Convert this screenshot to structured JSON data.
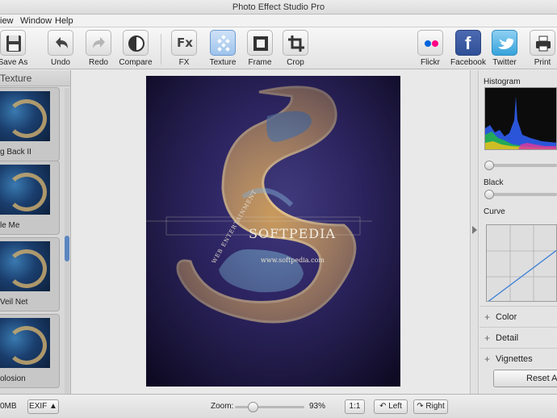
{
  "window": {
    "title": "Photo Effect Studio Pro"
  },
  "menu": [
    "iew",
    "Window",
    "Help"
  ],
  "toolbar": {
    "save_as": "Save As",
    "undo": "Undo",
    "redo": "Redo",
    "compare": "Compare",
    "fx": "FX",
    "texture": "Texture",
    "frame": "Frame",
    "crop": "Crop",
    "flickr": "Flickr",
    "facebook": "Facebook",
    "twitter": "Twitter",
    "print": "Print",
    "fx_glyph": "Fx",
    "facebook_glyph": "f"
  },
  "left_panel": {
    "header": "Texture",
    "thumbnails": [
      {
        "caption": "g Back II"
      },
      {
        "caption": "le Me"
      },
      {
        "caption": "Veil Net"
      },
      {
        "caption": "olosion"
      }
    ]
  },
  "image": {
    "watermark": "SOFTPEDIA",
    "url_text": "www.softpedia.com",
    "side_text": "WEB ENTERTAINMENT"
  },
  "right_panel": {
    "histogram_label": "Histogram",
    "black_label": "Black",
    "curve_label": "Curve",
    "sections": [
      "Color",
      "Detail",
      "Vignettes"
    ],
    "reset_label": "Reset Al"
  },
  "status_bar": {
    "size_text": "0MB",
    "exif_label": "EXIF ▲",
    "zoom_label": "Zoom:",
    "zoom_value": "93%",
    "ratio_label": "1:1",
    "left_label": "Left",
    "right_label": "Right"
  },
  "colors": {
    "accent": "#5b86c0",
    "texture_active": "#9ec3ec"
  }
}
